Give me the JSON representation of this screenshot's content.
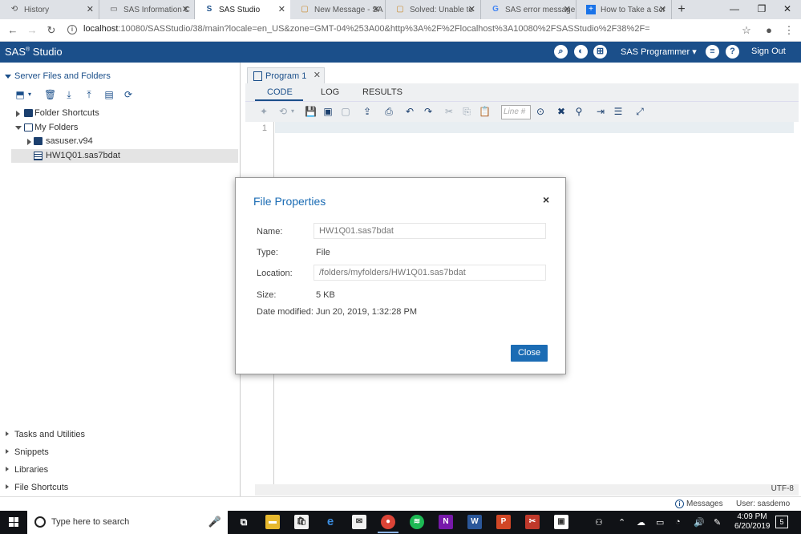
{
  "browser": {
    "tabs": [
      {
        "label": "History",
        "icon": "history-icon",
        "active": false
      },
      {
        "label": "SAS Information C",
        "icon": "page-icon",
        "active": false
      },
      {
        "label": "SAS Studio",
        "icon": "sas-icon",
        "active": true
      },
      {
        "label": "New Message - SA",
        "icon": "chat-icon",
        "active": false
      },
      {
        "label": "Solved: Unable to",
        "icon": "chat-icon",
        "active": false
      },
      {
        "label": "SAS error message",
        "icon": "google-icon",
        "active": false
      },
      {
        "label": "How to Take a Scr",
        "icon": "plus-icon",
        "active": false
      }
    ],
    "url_host": "localhost",
    "url_rest": ":10080/SASStudio/38/main?locale=en_US&zone=GMT-04%253A00&http%3A%2F%2Flocalhost%3A10080%2FSASStudio%2F38%2F="
  },
  "header": {
    "logo": "SAS",
    "logo_sup": "®",
    "logo_product": " Studio",
    "role": "SAS Programmer ▾",
    "signout": "Sign Out"
  },
  "left_panel": {
    "title": "Server Files and Folders",
    "tree": [
      {
        "label": "Folder Shortcuts"
      },
      {
        "label": "My Folders"
      },
      {
        "label": "sasuser.v94"
      },
      {
        "label": "HW1Q01.sas7bdat"
      }
    ],
    "bottom_sections": [
      "Tasks and Utilities",
      "Snippets",
      "Libraries",
      "File Shortcuts"
    ]
  },
  "editor": {
    "program_tab": "Program 1",
    "subtabs": [
      "CODE",
      "LOG",
      "RESULTS"
    ],
    "line_placeholder": "Line #",
    "line_numbers": [
      "1"
    ],
    "encoding": "UTF-8"
  },
  "dialog": {
    "title": "File Properties",
    "close_glyph": "×",
    "name_label": "Name:",
    "name_value": "HW1Q01.sas7bdat",
    "type_label": "Type:",
    "type_value": "File",
    "location_label": "Location:",
    "location_value": "/folders/myfolders/HW1Q01.sas7bdat",
    "size_label": "Size:",
    "size_value": "5 KB",
    "modified_label": "Date modified:",
    "modified_value": "Jun 20, 2019, 1:32:28 PM",
    "close_button": "Close"
  },
  "status": {
    "messages": "Messages",
    "user": "User: sasdemo"
  },
  "taskbar": {
    "search_placeholder": "Type here to search",
    "time": "4:09 PM",
    "date": "6/20/2019",
    "notification_count": "5"
  },
  "colors": {
    "sas_blue": "#1b4f8a",
    "dialog_accent": "#1b6cb4"
  }
}
